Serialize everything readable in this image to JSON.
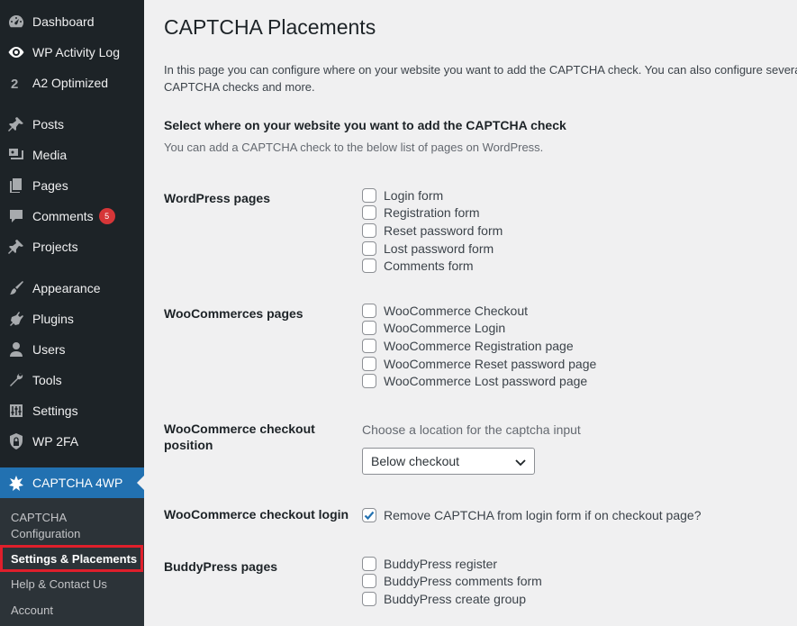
{
  "sidebar": {
    "items": [
      {
        "label": "Dashboard",
        "icon": "dashboard-icon"
      },
      {
        "label": "WP Activity Log",
        "icon": "eye-icon"
      },
      {
        "label": "A2 Optimized",
        "icon": "a2-icon"
      },
      {
        "label": "Posts",
        "icon": "pin-icon"
      },
      {
        "label": "Media",
        "icon": "media-icon"
      },
      {
        "label": "Pages",
        "icon": "pages-icon"
      },
      {
        "label": "Comments",
        "icon": "comment-icon",
        "badge": "5"
      },
      {
        "label": "Projects",
        "icon": "pin-icon"
      },
      {
        "label": "Appearance",
        "icon": "brush-icon"
      },
      {
        "label": "Plugins",
        "icon": "plugin-icon"
      },
      {
        "label": "Users",
        "icon": "user-icon"
      },
      {
        "label": "Tools",
        "icon": "wrench-icon"
      },
      {
        "label": "Settings",
        "icon": "sliders-icon"
      },
      {
        "label": "WP 2FA",
        "icon": "shield-icon"
      },
      {
        "label": "CAPTCHA 4WP",
        "icon": "captcha-icon"
      }
    ],
    "submenu": [
      {
        "label": "CAPTCHA Configuration"
      },
      {
        "label": "Settings & Placements"
      },
      {
        "label": "Help & Contact Us"
      },
      {
        "label": "Account"
      }
    ]
  },
  "main": {
    "title": "CAPTCHA Placements",
    "intro": "In this page you can configure where on your website you want to add the CAPTCHA check. You can also configure several CAPTCHA checks and more.",
    "section_title": "Select where on your website you want to add the CAPTCHA check",
    "section_desc": "You can add a CAPTCHA check to the below list of pages on WordPress.",
    "wordpress": {
      "label": "WordPress pages",
      "options": [
        "Login form",
        "Registration form",
        "Reset password form",
        "Lost password form",
        "Comments form"
      ]
    },
    "woocommerce": {
      "label": "WooCommerces pages",
      "options": [
        "WooCommerce Checkout",
        "WooCommerce Login",
        "WooCommerce Registration page",
        "WooCommerce Reset password page",
        "WooCommerce Lost password page"
      ]
    },
    "checkout_position": {
      "label": "WooCommerce checkout position",
      "hint": "Choose a location for the captcha input",
      "selected": "Below checkout"
    },
    "checkout_login": {
      "label": "WooCommerce checkout login",
      "option": "Remove CAPTCHA from login form if on checkout page?",
      "checked": true
    },
    "buddypress": {
      "label": "BuddyPress pages",
      "options": [
        "BuddyPress register",
        "BuddyPress comments form",
        "BuddyPress create group"
      ]
    }
  },
  "colors": {
    "sidebar_bg": "#1d2327",
    "active_bg": "#2271b1",
    "highlight": "#e01f2b",
    "badge": "#d63638"
  }
}
